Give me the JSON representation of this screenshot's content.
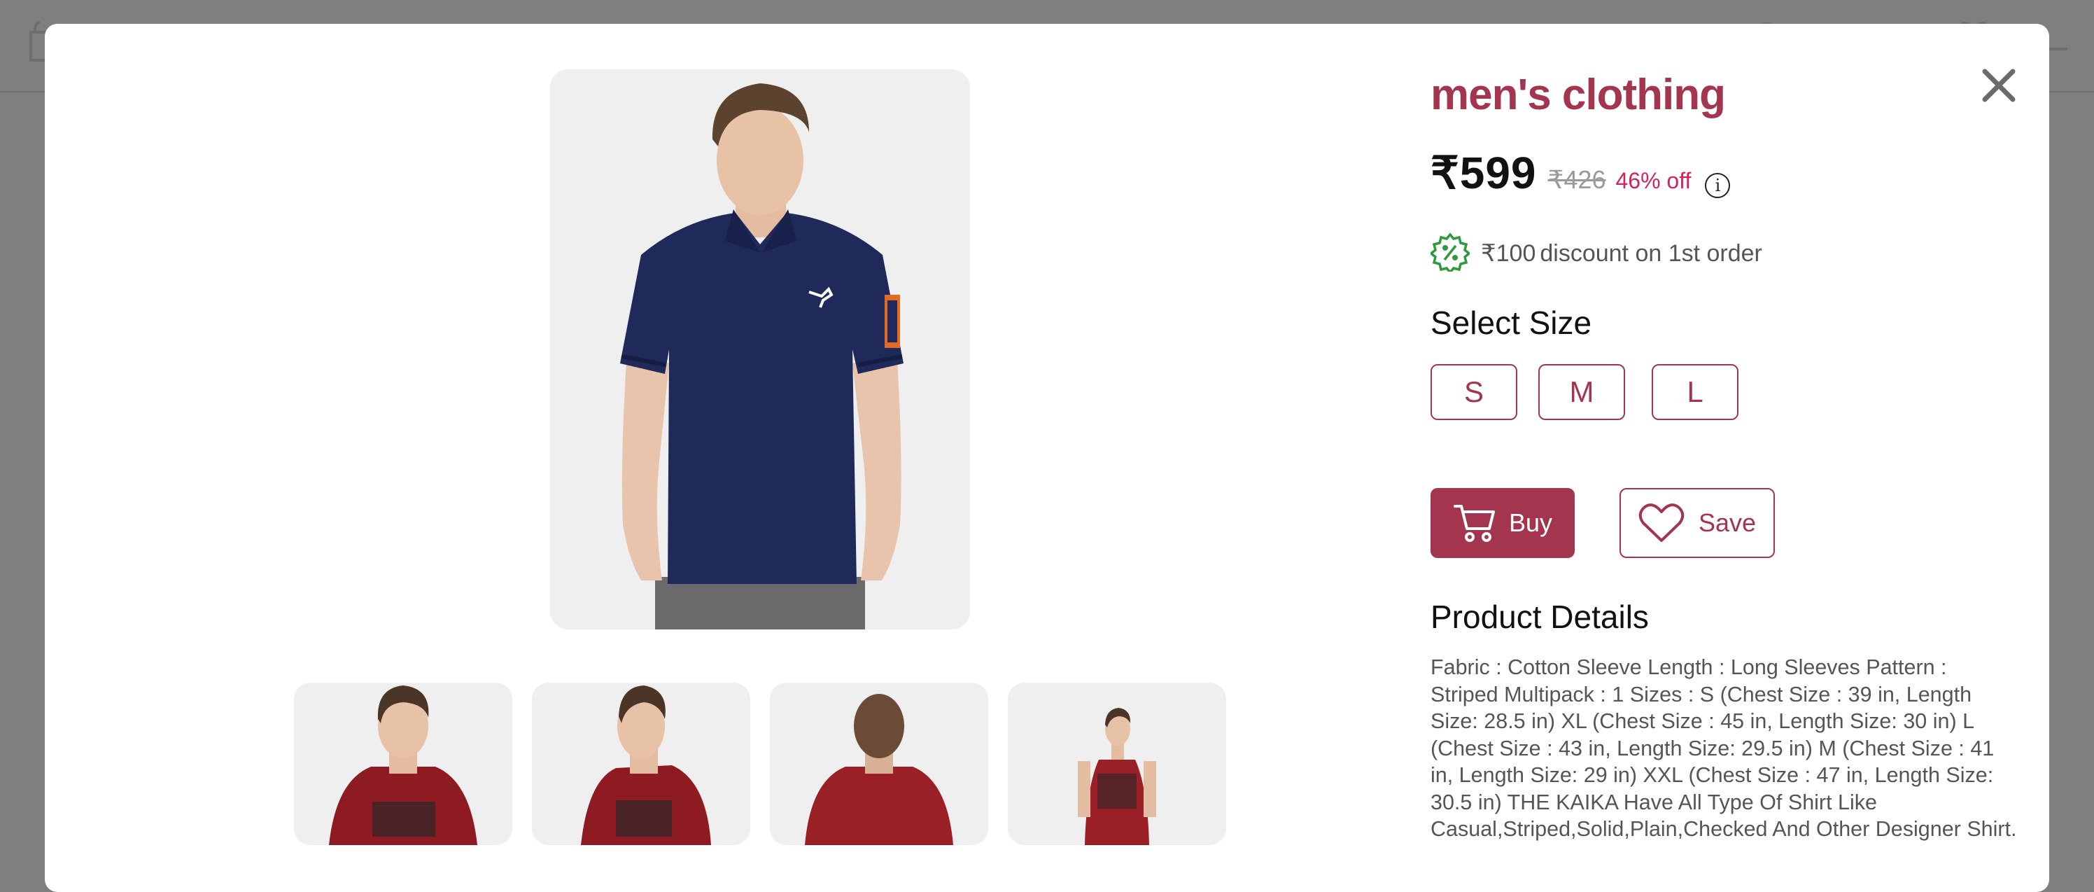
{
  "product": {
    "title": "men's clothing",
    "price": "₹599",
    "mrp": "₹426",
    "discount_percent": "46% off",
    "info_icon": "info-icon",
    "first_order_amount": "₹100",
    "first_order_text": "discount on 1st order",
    "first_order_icon": "percent-badge-icon"
  },
  "size_section": {
    "label": "Select Size",
    "sizes": [
      "S",
      "M",
      "L"
    ]
  },
  "actions": {
    "buy_label": "Buy",
    "buy_icon": "cart-icon",
    "save_label": "Save",
    "save_icon": "heart-icon"
  },
  "details": {
    "heading": "Product Details",
    "text": "Fabric : Cotton Sleeve Length : Long Sleeves Pattern : Striped Multipack : 1 Sizes : S (Chest Size : 39 in, Length Size: 28.5 in) XL (Chest Size : 45 in, Length Size: 30 in) L (Chest Size : 43 in, Length Size: 29.5 in) M (Chest Size : 41 in, Length Size: 29 in) XXL (Chest Size : 47 in, Length Size: 30.5 in) THE KAIKA Have All Type Of Shirt Like Casual,Striped,Solid,Plain,Checked And Other Designer Shirt."
  },
  "gallery": {
    "main_image": "navy-polo-shirt-photo",
    "thumbnails": [
      "red-tshirt-front-photo",
      "red-tshirt-side-photo",
      "red-tshirt-back-photo",
      "red-tshirt-full-photo"
    ]
  },
  "colors": {
    "brand": "#a3354f",
    "discount": "#d2245a",
    "overlay": "#7f7f7f"
  }
}
